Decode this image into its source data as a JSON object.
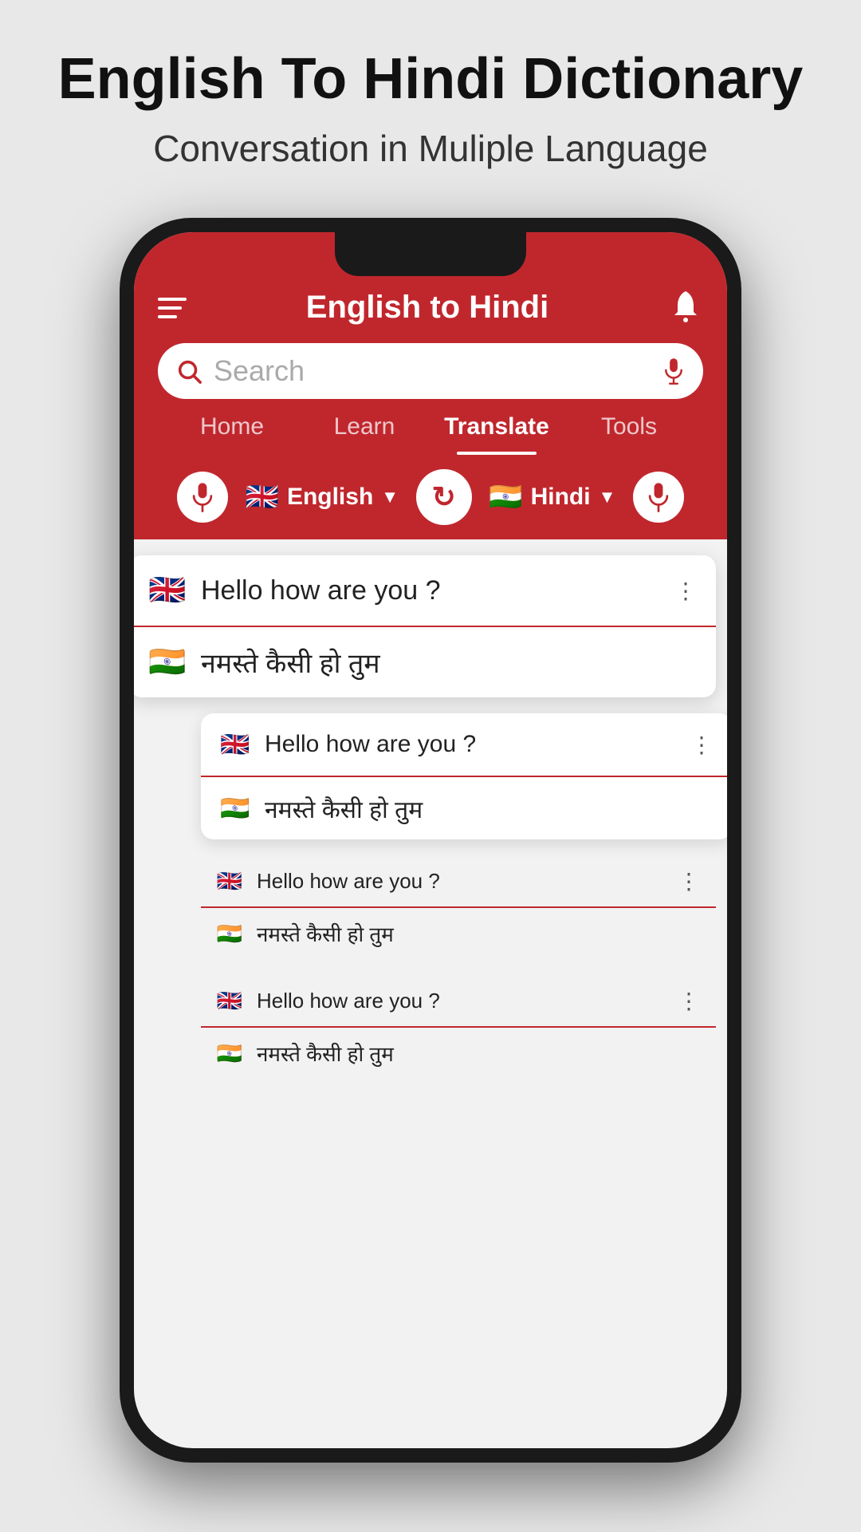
{
  "header": {
    "title": "English To Hindi Dictionary",
    "subtitle": "Conversation in Muliple Language"
  },
  "app": {
    "title": "English to Hindi",
    "search_placeholder": "Search",
    "nav_tabs": [
      {
        "label": "Home",
        "active": false
      },
      {
        "label": "Learn",
        "active": false
      },
      {
        "label": "Translate",
        "active": true
      },
      {
        "label": "Tools",
        "active": false
      }
    ],
    "lang_from": "English",
    "lang_to": "Hindi",
    "cards": [
      {
        "english": "Hello how are you ?",
        "hindi": "नमस्ते कैसी हो तुम",
        "size": "large"
      },
      {
        "english": "Hello how are you ?",
        "hindi": "नमस्ते कैसी हो तुम",
        "size": "medium"
      },
      {
        "english": "Hello how are you ?",
        "hindi": "नमस्ते कैसी हो तुम",
        "size": "small"
      },
      {
        "english": "Hello how are you ?",
        "hindi": "नमस्ते कैसी हो तुम",
        "size": "small"
      }
    ]
  },
  "colors": {
    "red": "#c0272d",
    "dark": "#1a1a1a"
  }
}
